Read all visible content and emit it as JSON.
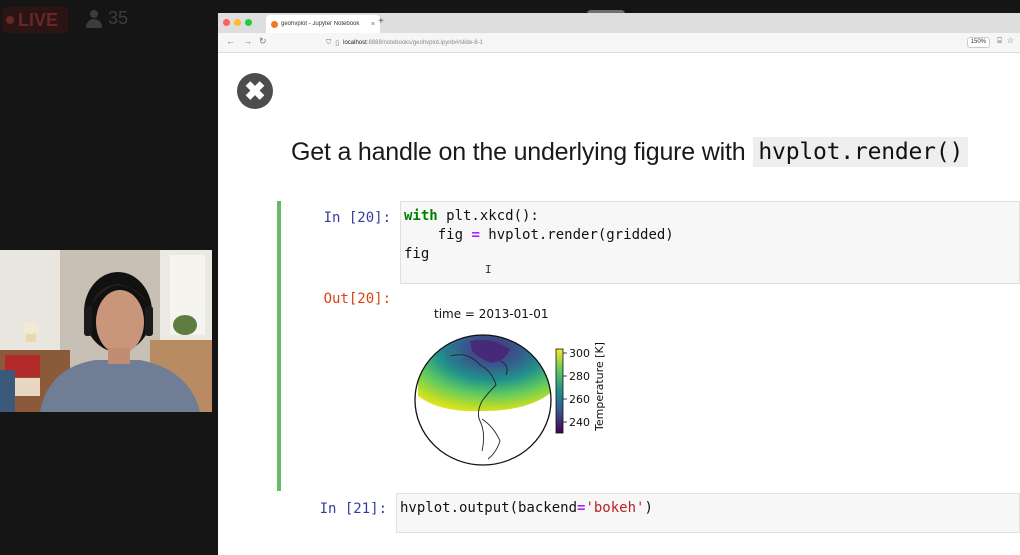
{
  "stream": {
    "live_label": "LIVE",
    "viewer_count": "35"
  },
  "browser": {
    "tab_title": "geohvplot - Jupyter Notebook",
    "tab_close": "×",
    "new_tab": "+",
    "url_prefix": "localhost",
    "url_rest": ":8888/notebooks/geohvplot.ipynb#/slide-8-1",
    "zoom": "150%"
  },
  "slide": {
    "close_glyph": "✖",
    "heading_text": "Get a handle on the underlying figure with",
    "heading_code": "hvplot.render()"
  },
  "cells": [
    {
      "prompt": "In [20]:",
      "lines": {
        "l1_kw": "with",
        "l1_rest": " plt.xkcd():",
        "l2_indent": "    fig ",
        "l2_op": "=",
        "l2_rest": " hvplot.render(gridded)",
        "l3": "fig"
      },
      "out_prompt": "Out[20]:"
    },
    {
      "prompt": "In [21]:",
      "lines": {
        "pre": "hvplot.output(backend",
        "op": "=",
        "str": "'bokeh'",
        "post": ")"
      }
    }
  ],
  "figure": {
    "title": "time = 2013-01-01",
    "colorbar_label": "Temperature [K]",
    "colorbar_ticks": [
      "300",
      "280",
      "260",
      "240"
    ],
    "colormap": "viridis"
  }
}
